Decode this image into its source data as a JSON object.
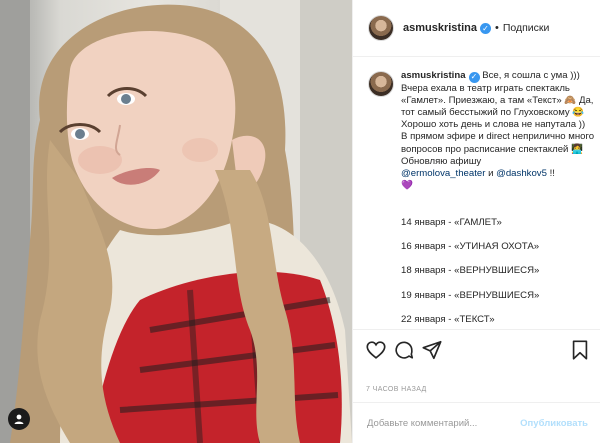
{
  "post": {
    "username": "asmuskristina",
    "verified": true,
    "follow_label": "Подписки",
    "separator": "•",
    "caption_intro": " Все, я сошла с ума ))) Вчера ехала в театр играть спектакль «Гамлет». Приезжаю, а там «Текст» 🙈 Да, тот самый бесстыжий по Глуховскому 😂 Хорошо хоть день и слова не напутала ))\nВ прямом эфире и direct неприлично много вопросов про расписание спектаклей 👩‍💻\nОбновляю афишу\n",
    "mention_1": "@ermolova_theater",
    "and_word": " и ",
    "mention_2": "@dashkov5",
    "caption_outro": " !!\n💜",
    "schedule": [
      "14 января - «ГАМЛЕТ»",
      "16 января - «УТИНАЯ ОХОТА»",
      "18 января - «ВЕРНУВШИЕСЯ»",
      "19 января - «ВЕРНУВШИЕСЯ»",
      "22 января - «ТЕКСТ»"
    ],
    "timestamp": "7 ЧАСОВ НАЗАД"
  },
  "comment": {
    "placeholder": "Добавьте комментарий...",
    "post_label": "Опубликовать"
  },
  "icons": [
    "heart-icon",
    "comment-icon",
    "share-icon",
    "bookmark-icon",
    "photo-corner-icon"
  ],
  "colors": {
    "accent": "#3897f0",
    "post_disabled": "#b2dffc",
    "muted_text": "#999999",
    "mention": "#003569"
  }
}
